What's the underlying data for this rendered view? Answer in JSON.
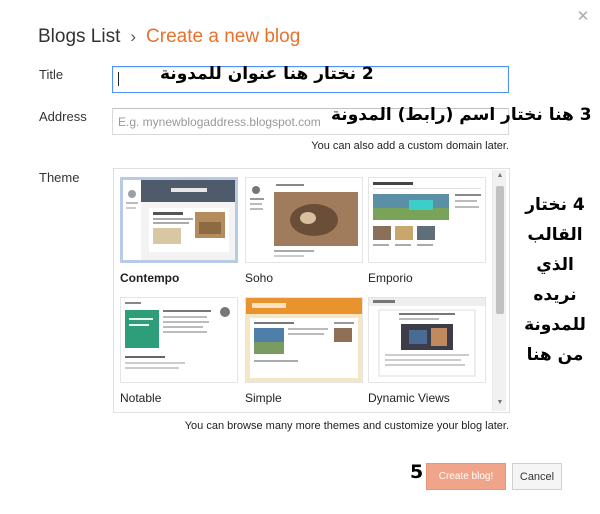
{
  "header": {
    "breadcrumb_root": "Blogs List",
    "breadcrumb_separator": "›",
    "breadcrumb_current": "Create a new blog",
    "close_glyph": "✕"
  },
  "form": {
    "title_label": "Title",
    "title_value": "",
    "address_label": "Address",
    "address_placeholder": "E.g. mynewblogaddress.blogspot.com",
    "address_hint": "You can also add a custom domain later.",
    "theme_label": "Theme",
    "theme_hint": "You can browse many more themes and customize your blog later."
  },
  "themes": [
    {
      "name": "Contempo",
      "selected": true
    },
    {
      "name": "Soho",
      "selected": false
    },
    {
      "name": "Emporio",
      "selected": false
    },
    {
      "name": "Notable",
      "selected": false
    },
    {
      "name": "Simple",
      "selected": false
    },
    {
      "name": "Dynamic Views",
      "selected": false
    }
  ],
  "buttons": {
    "create": "Create blog!",
    "cancel": "Cancel"
  },
  "annotations": {
    "step2": "2  نختار هنا عنوان للمدونة",
    "step3": "3 هنا نختار اسم (رابط) المدونة",
    "step4": "4 نختار القالب الذي نريده للمدونة من هنا",
    "step5": "5"
  },
  "colors": {
    "accent": "#e8722c",
    "create_button": "#f0a58a",
    "focus_border": "#4d90fe"
  }
}
